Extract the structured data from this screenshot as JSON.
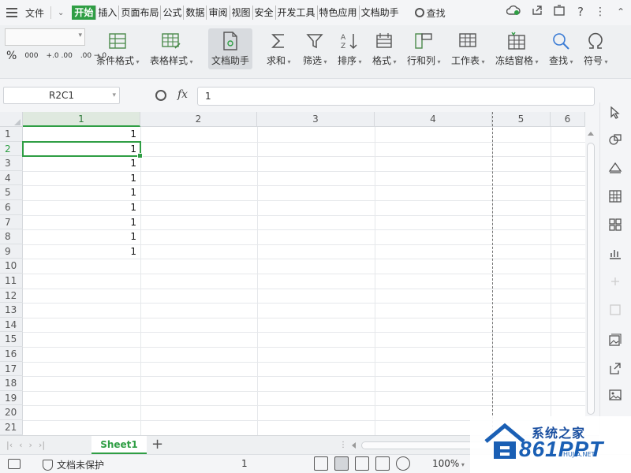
{
  "menu": {
    "file_label": "文件",
    "tabs": [
      "开始",
      "插入",
      "页面布局",
      "公式",
      "数据",
      "审阅",
      "视图",
      "安全",
      "开发工具",
      "特色应用",
      "文档助手"
    ],
    "active_tab": "开始",
    "search_label": "查找"
  },
  "ribbon": {
    "buttons": [
      {
        "label": "条件格式",
        "icon": "conditional-format-icon"
      },
      {
        "label": "表格样式",
        "icon": "table-style-icon"
      },
      {
        "label": "文档助手",
        "icon": "doc-assistant-icon"
      },
      {
        "label": "求和",
        "icon": "sum-icon"
      },
      {
        "label": "筛选",
        "icon": "filter-icon"
      },
      {
        "label": "排序",
        "icon": "sort-icon"
      },
      {
        "label": "格式",
        "icon": "format-icon"
      },
      {
        "label": "行和列",
        "icon": "rows-cols-icon"
      },
      {
        "label": "工作表",
        "icon": "worksheet-icon"
      },
      {
        "label": "冻结窗格",
        "icon": "freeze-panes-icon"
      },
      {
        "label": "查找",
        "icon": "find-icon"
      },
      {
        "label": "符号",
        "icon": "symbol-icon"
      }
    ],
    "number_format": {
      "percent": "%",
      "thousands": "000",
      "inc_decimal": "+.0 .00",
      "dec_decimal": ".00 →.0"
    }
  },
  "formula_bar": {
    "name_box": "R2C1",
    "fx_label": "fx",
    "value": "1"
  },
  "sheet": {
    "columns": [
      "1",
      "2",
      "3",
      "4",
      "5",
      "6"
    ],
    "selected_column": "1",
    "rows": [
      "1",
      "2",
      "3",
      "4",
      "5",
      "6",
      "7",
      "8",
      "9",
      "10",
      "11",
      "12",
      "13",
      "14",
      "15",
      "16",
      "17",
      "18",
      "19",
      "20",
      "21"
    ],
    "selected_row": "2",
    "column_a_values": [
      "1",
      "1",
      "1",
      "1",
      "1",
      "1",
      "1",
      "1",
      "1"
    ]
  },
  "sheet_tabs": {
    "tabs": [
      "Sheet1"
    ],
    "active": "Sheet1",
    "add_label": "+"
  },
  "status": {
    "protection": "文档未保护",
    "count": "1",
    "zoom": "100%"
  },
  "watermark": {
    "title": "系统之家",
    "brand": "861PPT",
    "url": "HUJIA.NET"
  },
  "colors": {
    "accent": "#2f9e44",
    "grid_line": "#e6e8eb",
    "header_bg": "#eef0f3",
    "watermark_blue": "#1a5fb4"
  }
}
